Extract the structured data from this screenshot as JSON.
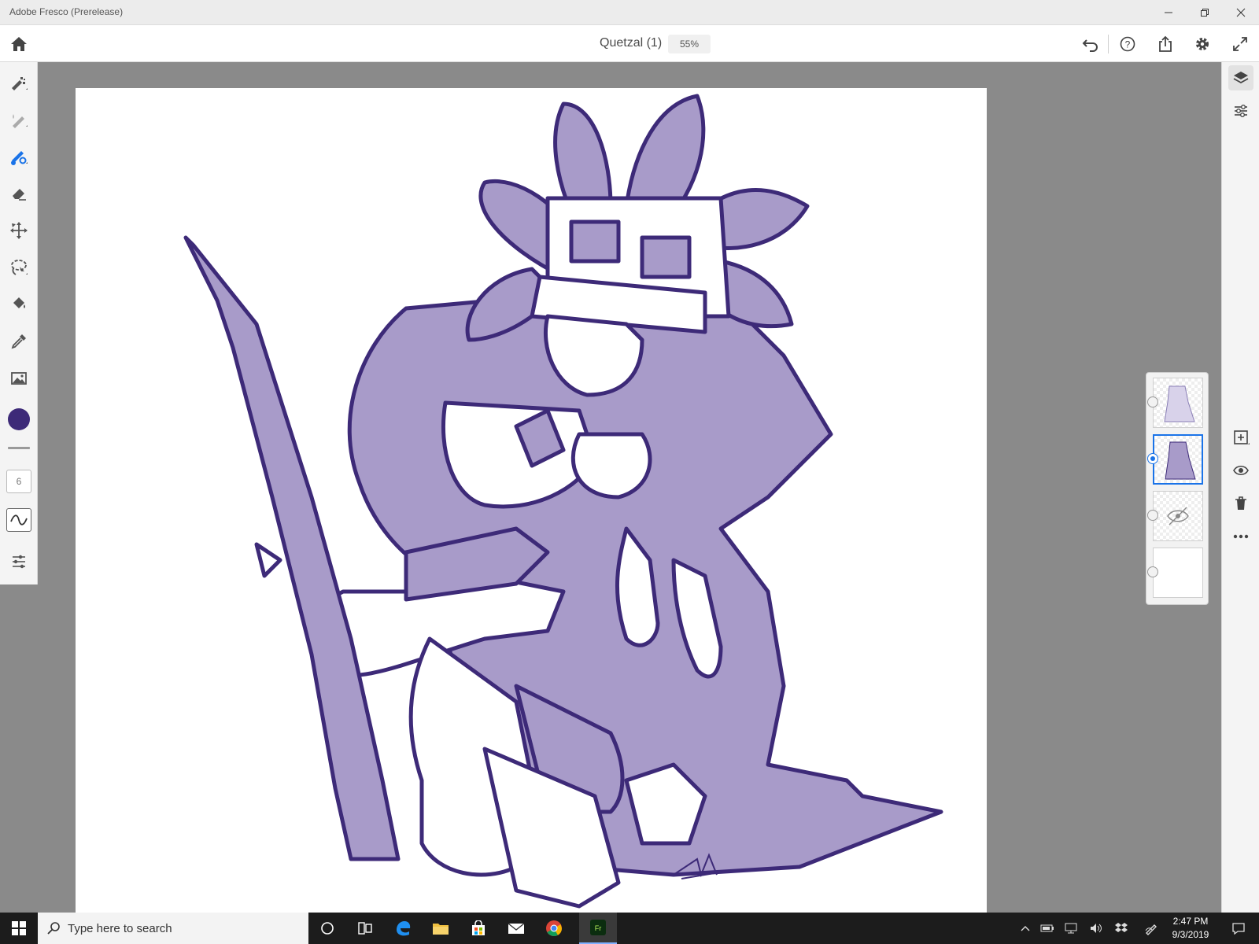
{
  "window": {
    "title": "Adobe Fresco (Prerelease)",
    "controls": [
      "minimize",
      "restore",
      "close"
    ]
  },
  "appbar": {
    "document_title": "Quetzal (1)",
    "zoom": "55%",
    "icons": [
      "home-icon",
      "undo-icon",
      "help-icon",
      "share-icon",
      "settings-icon",
      "fullscreen-icon"
    ]
  },
  "left_toolbar": {
    "tools": [
      "pixel-brush",
      "live-brush",
      "vector-brush",
      "eraser",
      "transform",
      "lasso-select",
      "fill",
      "eyedropper",
      "place-image"
    ],
    "active_tool": "vector-brush",
    "color": "#3d2a78",
    "brush_size": "6"
  },
  "right_toolbar": {
    "tools": [
      "layers",
      "layer-properties"
    ],
    "layer_actions": [
      "add-layer",
      "visibility",
      "delete-layer",
      "more"
    ]
  },
  "layers": [
    {
      "type": "pixel",
      "selected": false,
      "visible": true
    },
    {
      "type": "pixel",
      "selected": true,
      "visible": true
    },
    {
      "type": "pixel",
      "selected": false,
      "visible": false
    },
    {
      "type": "background",
      "selected": false,
      "visible": true
    }
  ],
  "canvas": {
    "background": "#ffffff",
    "ink_color": "#3d2a78",
    "fill_color": "#a89bc9"
  },
  "taskbar": {
    "search_placeholder": "Type here to search",
    "time": "2:47 PM",
    "date": "9/3/2019"
  },
  "colors": {
    "accent": "#1a73e8",
    "ink": "#3d2a78",
    "shade": "#a89bc9"
  }
}
